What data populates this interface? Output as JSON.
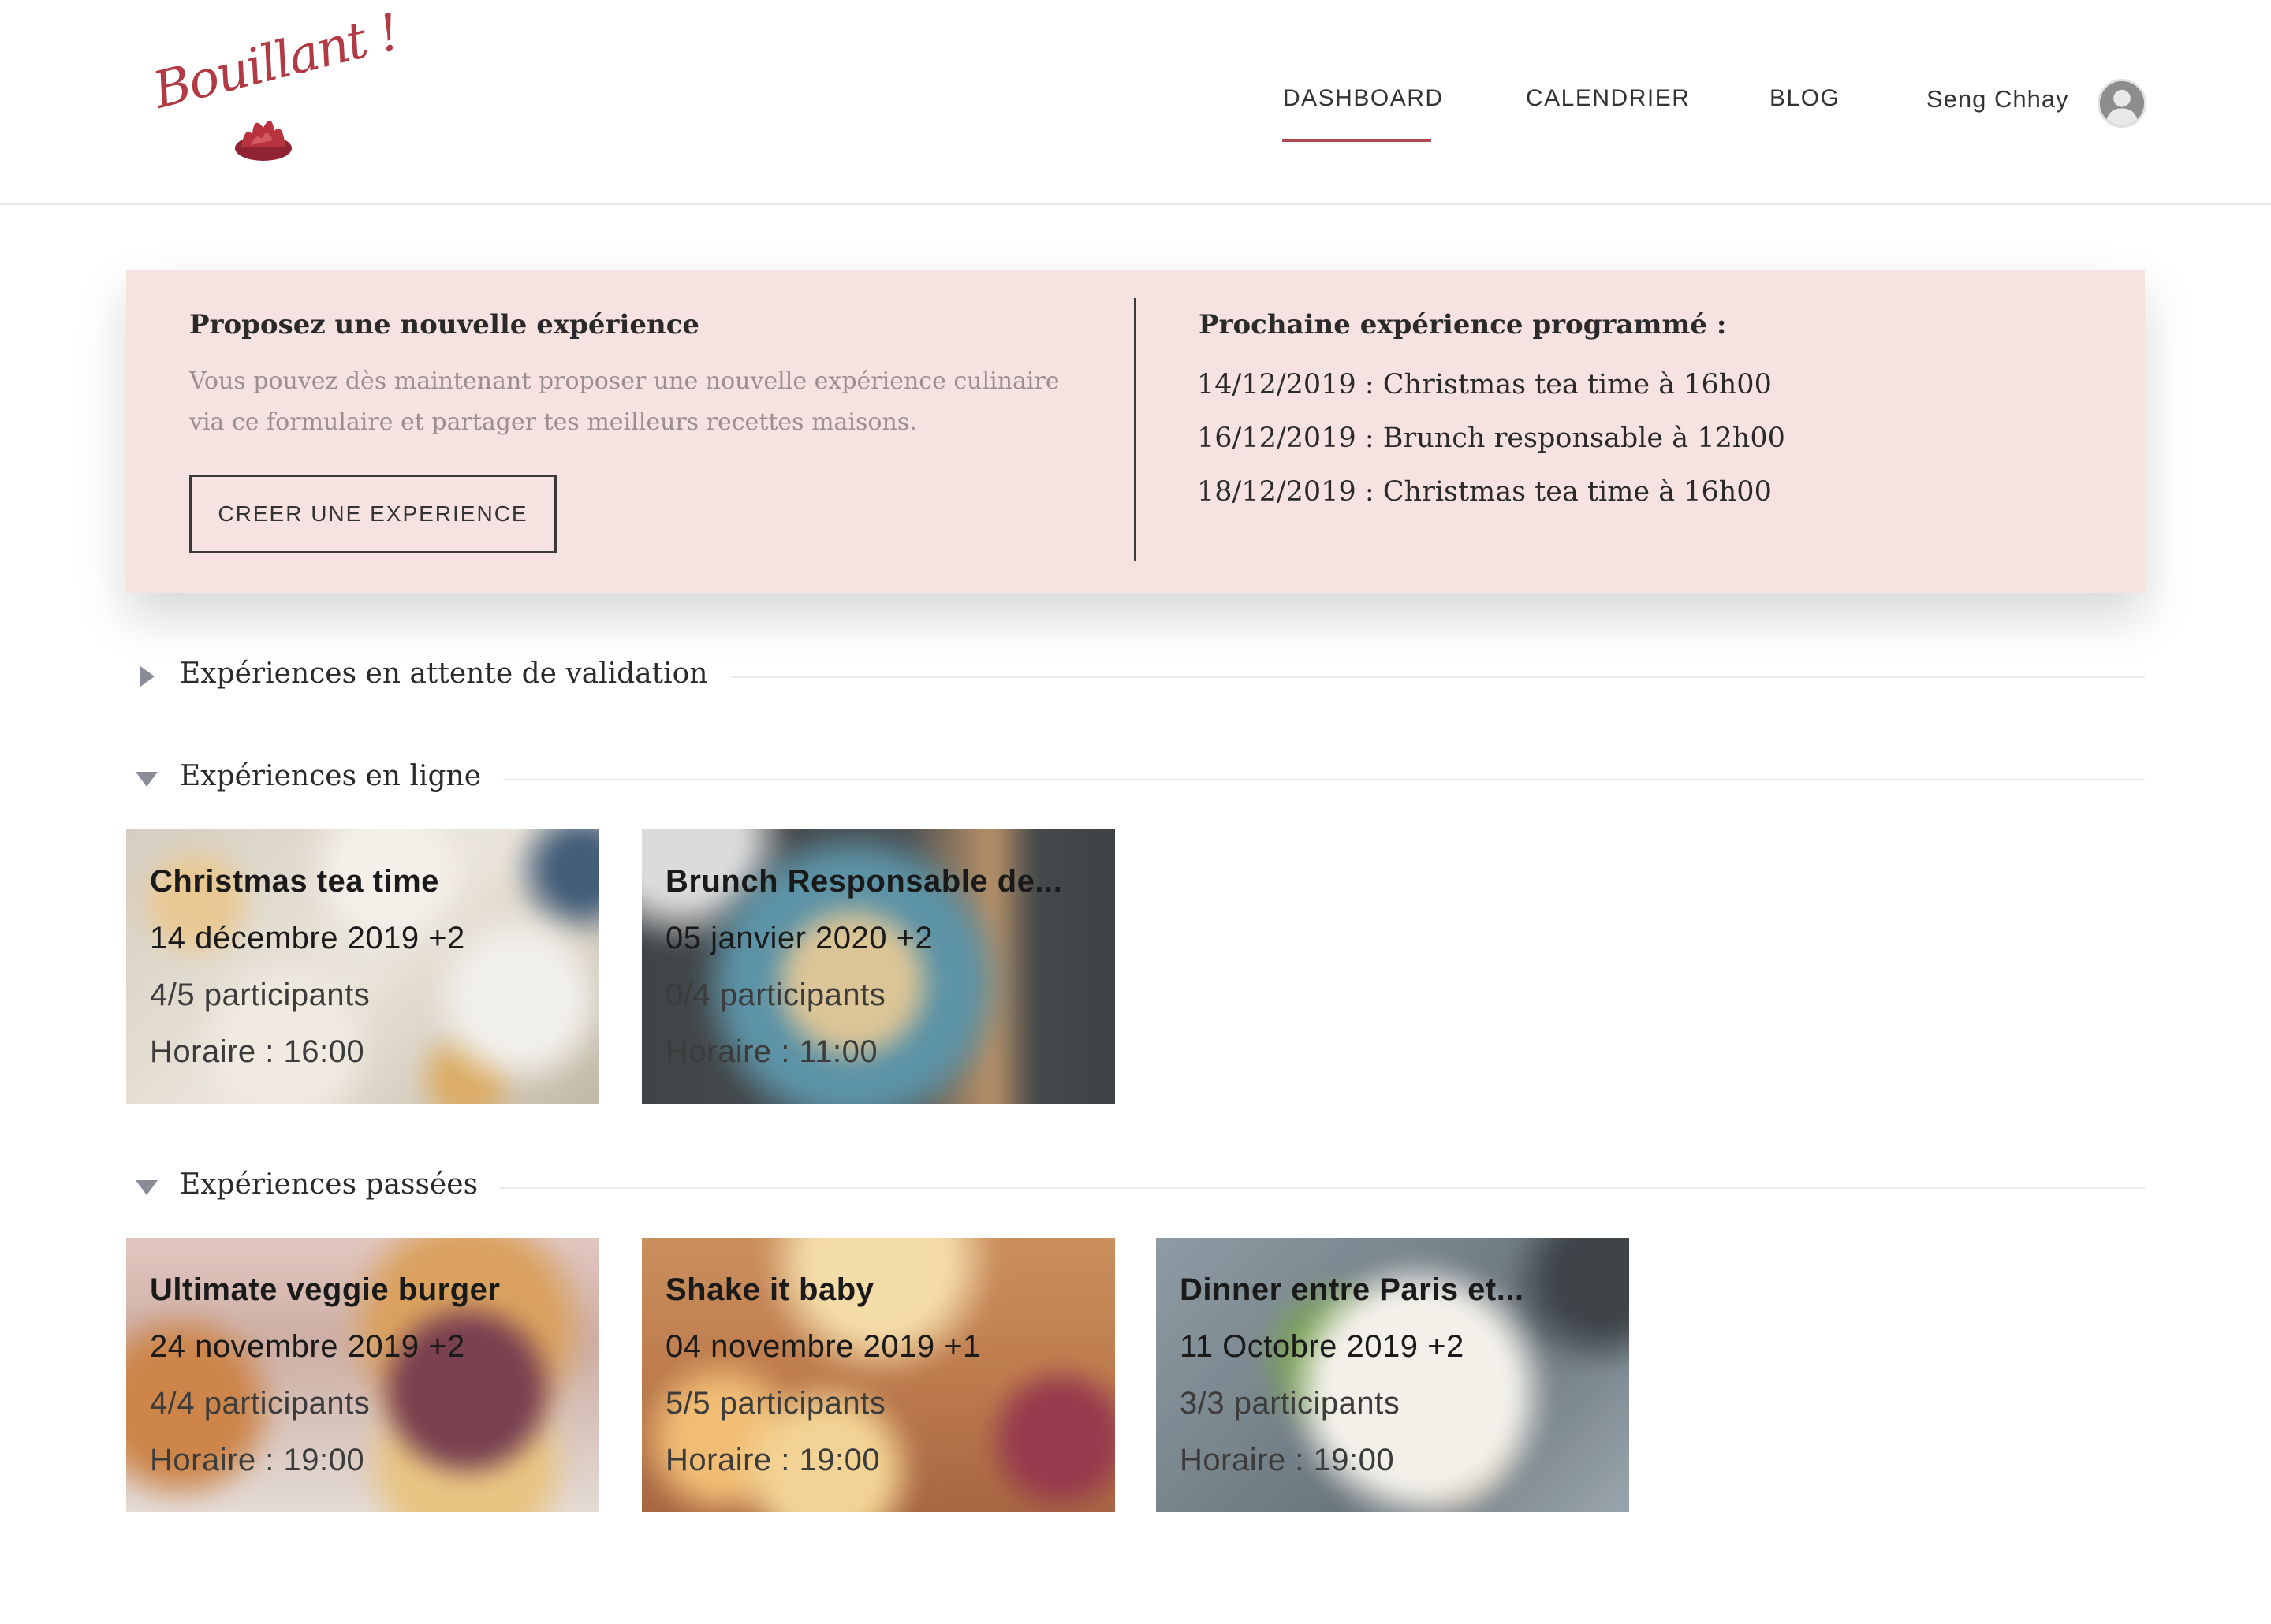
{
  "header": {
    "logo_text": "Bouillant !",
    "nav": {
      "dashboard": "DASHBOARD",
      "calendrier": "CALENDRIER",
      "blog": "BLOG"
    },
    "active_nav": "DASHBOARD",
    "user_name": "Seng Chhay"
  },
  "panel": {
    "title": "Proposez une nouvelle expérience",
    "description": "Vous pouvez dès maintenant proposer une nouvelle expérience culinaire via ce formulaire et partager tes meilleurs recettes maisons.",
    "button_label": "CREER UNE EXPERIENCE",
    "right_title": "Prochaine expérience programmé :",
    "scheduled": [
      "14/12/2019 : Christmas tea time à 16h00",
      "16/12/2019 : Brunch responsable à 12h00",
      "18/12/2019 : Christmas tea time à 16h00"
    ]
  },
  "sections": {
    "pending": {
      "title": "Expériences en attente de validation",
      "expanded": false
    },
    "online": {
      "title": "Expériences en ligne",
      "expanded": true
    },
    "past": {
      "title": "Expériences passées",
      "expanded": true
    }
  },
  "online_cards": [
    {
      "title": "Christmas tea time",
      "date": "14 décembre 2019 +2",
      "participants": "4/5 participants",
      "time": "Horaire : 16:00"
    },
    {
      "title": "Brunch Responsable de...",
      "date": "05 janvier 2020 +2",
      "participants": "0/4 participants",
      "time": "Horaire : 11:00"
    }
  ],
  "past_cards": [
    {
      "title": "Ultimate veggie burger",
      "date": "24 novembre 2019 +2",
      "participants": "4/4 participants",
      "time": "Horaire : 19:00"
    },
    {
      "title": "Shake it baby",
      "date": "04 novembre 2019 +1",
      "participants": "5/5 participants",
      "time": "Horaire : 19:00"
    },
    {
      "title": "Dinner entre Paris et...",
      "date": "11 Octobre 2019 +2",
      "participants": "3/3 participants",
      "time": "Horaire : 19:00"
    }
  ],
  "colors": {
    "accent": "#b04a50",
    "panel_bg": "#f6e2e0",
    "logo": "#b23a44"
  },
  "icons": {
    "section_collapsed": "caret-right-icon",
    "section_expanded": "caret-down-icon",
    "avatar": "user-avatar-icon",
    "logo_flame": "flame-icon"
  }
}
